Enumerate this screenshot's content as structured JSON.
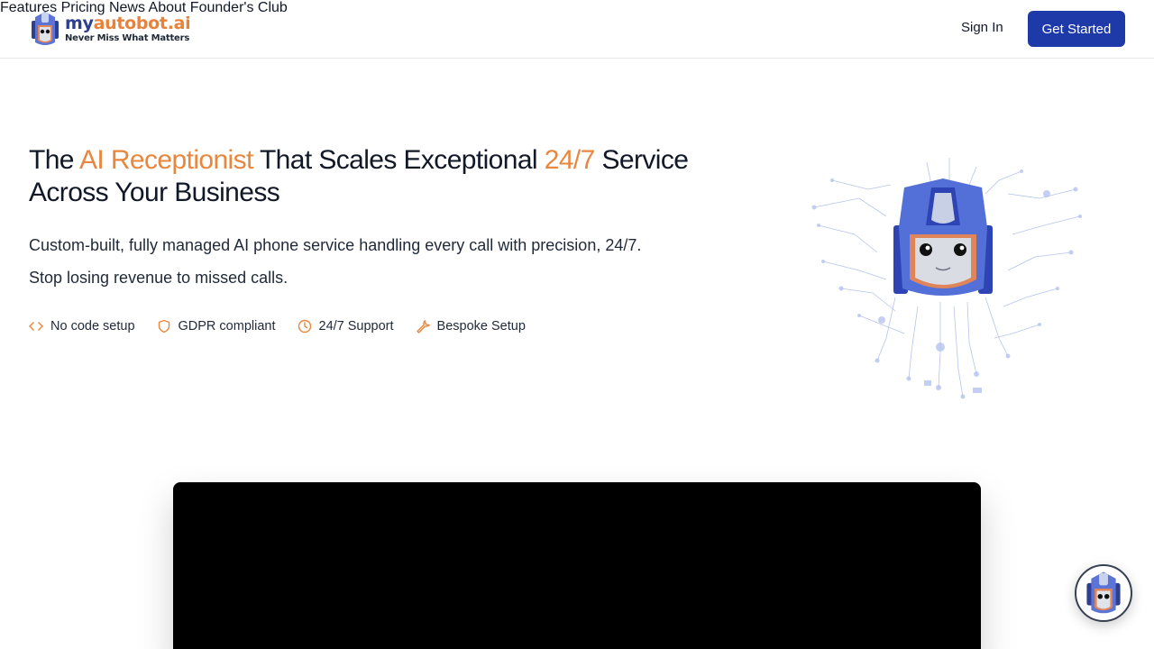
{
  "brand": {
    "name_part1": "my",
    "name_part2": "autobot.ai",
    "tagline": "Never Miss What Matters"
  },
  "nav": {
    "items": [
      {
        "label": "Features"
      },
      {
        "label": "Pricing"
      },
      {
        "label": "News"
      },
      {
        "label": "About"
      },
      {
        "label": "Founder's Club"
      }
    ],
    "sign_in": "Sign In",
    "cta": "Get Started"
  },
  "hero": {
    "title": {
      "t1": "The ",
      "accent1": "AI Receptionist",
      "t2": " That Scales Exceptional ",
      "accent2": "24/7",
      "t3": " Service Across Your Business"
    },
    "subtitle_line1": "Custom-built, fully managed AI phone service handling every call with precision, 24/7.",
    "subtitle_line2": "Stop losing revenue to missed calls.",
    "features": [
      {
        "icon": "code-icon",
        "label": "No code setup"
      },
      {
        "icon": "shield-icon",
        "label": "GDPR compliant"
      },
      {
        "icon": "clock-icon",
        "label": "24/7 Support"
      },
      {
        "icon": "wrench-icon",
        "label": "Bespoke Setup"
      }
    ]
  },
  "colors": {
    "accent": "#e8873f",
    "primary": "#1e3aa8",
    "brand_blue": "#2e3f8f"
  }
}
